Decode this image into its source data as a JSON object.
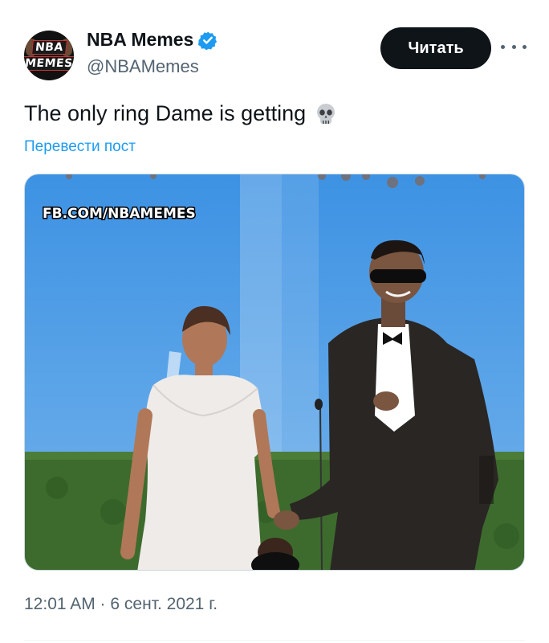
{
  "author": {
    "display_name": "NBA Memes",
    "handle": "@NBAMemes",
    "avatar_text_line1": "NBA",
    "avatar_text_line2": "MEMES",
    "verified": true,
    "verified_color": "#1d9bf0"
  },
  "actions": {
    "follow_label": "Читать",
    "more_icon": "more-horizontal-icon"
  },
  "tweet": {
    "text": "The only ring Dame is getting",
    "emoji": "skull-icon",
    "translate_label": "Перевести пост",
    "timestamp": "12:01 AM · 6 сент. 2021 г."
  },
  "media": {
    "watermark": "FB.COM/NBAMEMES",
    "description_colors": {
      "sky": "#4f9ee6",
      "hedge": "#3b6a2c",
      "suit": "#2a2624",
      "dress": "#f1efee"
    }
  },
  "colors": {
    "text_primary": "#0f1419",
    "text_secondary": "#536471",
    "link": "#1d9bf0",
    "button_bg": "#0f1419"
  }
}
